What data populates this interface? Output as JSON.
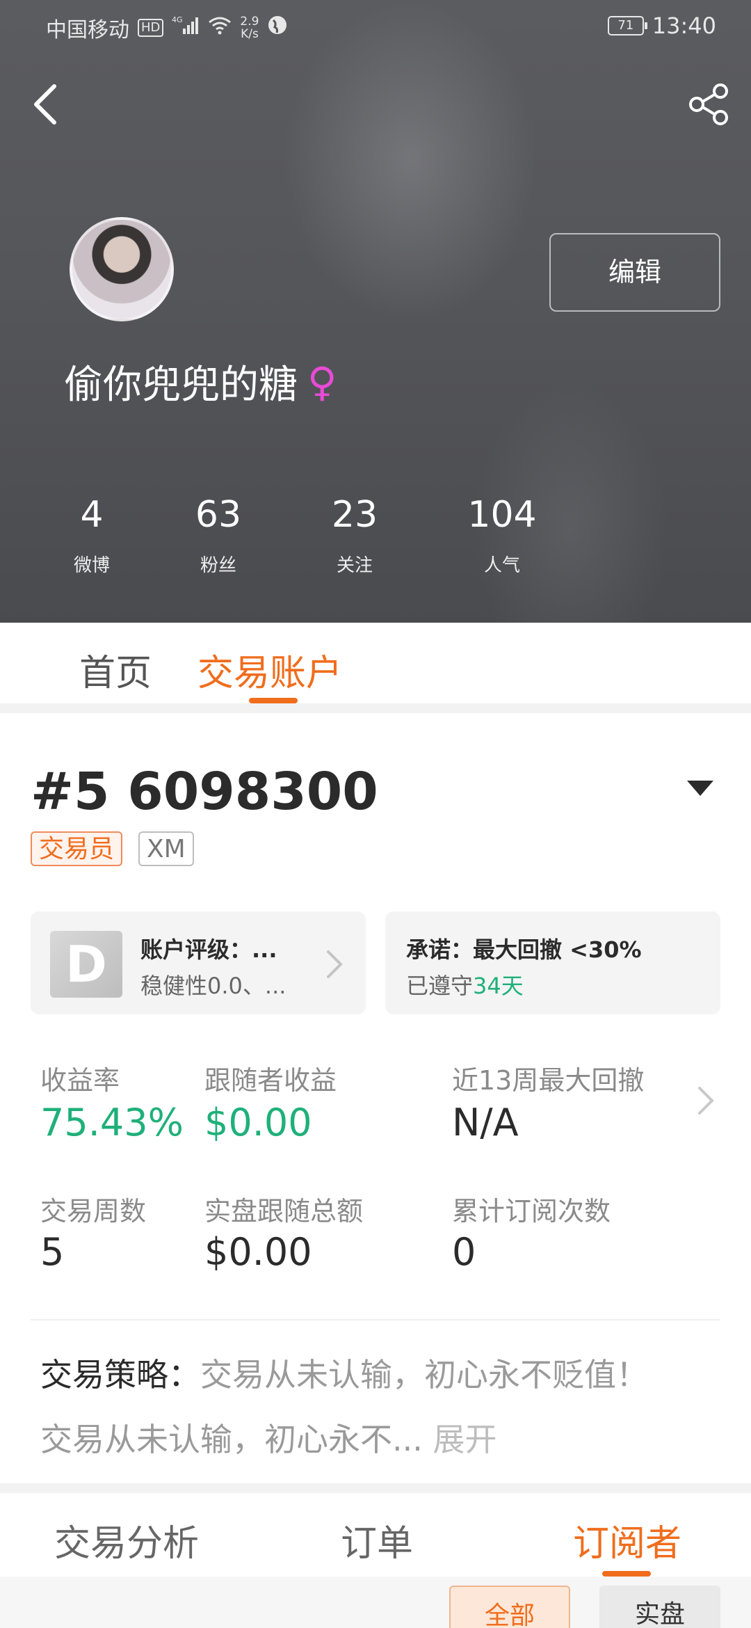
{
  "status_bar": {
    "carrier": "中国移动",
    "hd_badge": "HD",
    "network": "4G",
    "speed_value": "2.9",
    "speed_unit": "K/s",
    "battery": "71",
    "time": "13:40"
  },
  "profile": {
    "username": "偷你兜兜的糖",
    "gender_symbol": "♀",
    "edit_label": "编辑",
    "stats": [
      {
        "num": "4",
        "label": "微博"
      },
      {
        "num": "63",
        "label": "粉丝"
      },
      {
        "num": "23",
        "label": "关注"
      },
      {
        "num": "104",
        "label": "人气"
      }
    ]
  },
  "top_tabs": [
    {
      "label": "首页",
      "active": false
    },
    {
      "label": "交易账户",
      "active": true
    }
  ],
  "account": {
    "number": "#5 6098300",
    "tags": [
      "交易员",
      "XM"
    ],
    "rating_card": {
      "badge": "D",
      "title": "账户评级：...",
      "subtitle": "稳健性0.0、..."
    },
    "promise_card": {
      "title": "承诺：最大回撤 <30%",
      "kept_prefix": "已遵守",
      "kept_days": "34天"
    },
    "metrics": [
      {
        "label": "收益率",
        "value": "75.43%"
      },
      {
        "label": "跟随者收益",
        "value": "$0.00"
      },
      {
        "label": "近13周最大回撤",
        "value": "N/A"
      },
      {
        "label": "交易周数",
        "value": "5"
      },
      {
        "label": "实盘跟随总额",
        "value": "$0.00"
      },
      {
        "label": "累计订阅次数",
        "value": "0"
      }
    ],
    "strategy": {
      "key": "交易策略：",
      "value": "交易从未认输，初心永不贬值！",
      "body": "交易从未认输，初心永不...",
      "expand": "展开"
    }
  },
  "bottom_tabs": [
    {
      "label": "交易分析",
      "active": false
    },
    {
      "label": "订单",
      "active": false
    },
    {
      "label": "订阅者",
      "active": true
    }
  ],
  "filters": [
    "全部",
    "实盘"
  ],
  "colors": {
    "accent_orange": "#f06d1c",
    "positive_green": "#1fb07a",
    "gender_pink": "#e84bd6"
  }
}
